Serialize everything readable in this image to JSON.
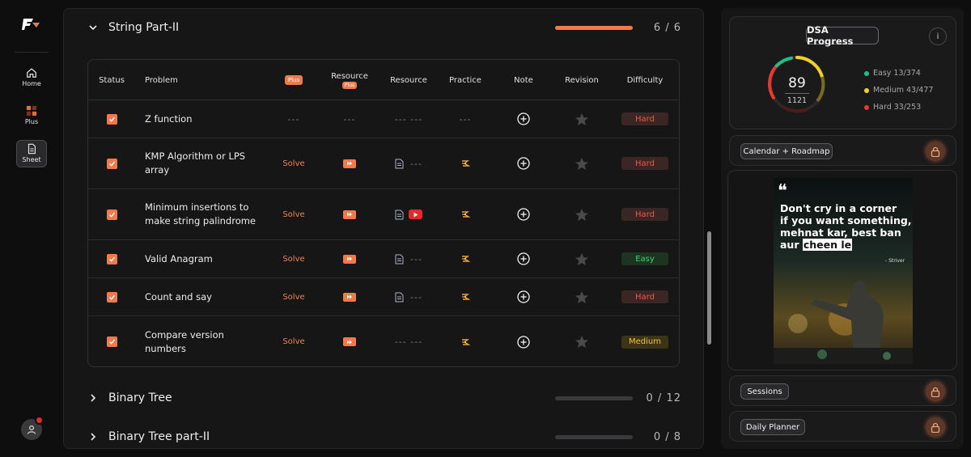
{
  "sidebar": {
    "items": [
      {
        "label": "Home",
        "icon": "home-icon"
      },
      {
        "label": "Plus",
        "icon": "plus-grid-icon"
      },
      {
        "label": "Sheet",
        "icon": "sheet-icon",
        "active": true
      }
    ]
  },
  "sections": [
    {
      "title": "String Part-II",
      "count": "6 / 6",
      "progress": 1.0,
      "expanded": true
    },
    {
      "title": "Binary Tree",
      "count": "0 / 12",
      "progress": 0.0,
      "expanded": false
    },
    {
      "title": "Binary Tree part-II",
      "count": "0 / 8",
      "progress": 0.0,
      "expanded": false
    }
  ],
  "table": {
    "headers": {
      "status": "Status",
      "problem": "Problem",
      "plus": "Plus",
      "resource_plus_label": "Resource",
      "resource_plus_tag": "Plus",
      "resource": "Resource",
      "practice": "Practice",
      "note": "Note",
      "revision": "Revision",
      "difficulty": "Difficulty"
    },
    "rows": [
      {
        "problem": "Z function",
        "plus": "---",
        "resource_plus": "---",
        "resource": "--- ---",
        "practice": "---",
        "difficulty": "Hard"
      },
      {
        "problem": "KMP Algorithm or LPS array",
        "plus": "Solve",
        "resource_plus": "video",
        "resource": "---",
        "practice": "codestudio",
        "difficulty": "Hard"
      },
      {
        "problem": "Minimum insertions to make string palindrome",
        "plus": "Solve",
        "resource_plus": "video",
        "resource": "youtube",
        "practice": "codestudio",
        "difficulty": "Hard"
      },
      {
        "problem": "Valid Anagram",
        "plus": "Solve",
        "resource_plus": "video",
        "resource": "---",
        "practice": "codestudio",
        "difficulty": "Easy"
      },
      {
        "problem": "Count and say",
        "plus": "Solve",
        "resource_plus": "video",
        "resource": "---",
        "practice": "codestudio",
        "difficulty": "Hard"
      },
      {
        "problem": "Compare version numbers",
        "plus": "Solve",
        "resource_plus": "video",
        "resource": "--- ---",
        "practice": "codestudio",
        "difficulty": "Medium"
      }
    ]
  },
  "progress": {
    "title": "DSA Progress",
    "info": "i",
    "solved": "89",
    "total": "1121",
    "easy": "Easy 13/374",
    "medium": "Medium 43/477",
    "hard": "Hard 33/253",
    "colors": {
      "easy": "#1fc18a",
      "medium": "#f2d024",
      "hard": "#e8372e"
    }
  },
  "links": {
    "calendar": "Calendar + Roadmap",
    "sessions": "Sessions",
    "planner": "Daily Planner"
  },
  "quote": {
    "mark": "❝",
    "line1": "Don't cry in a corner",
    "line2": "if you want something,",
    "line3": "mehnat kar, best ban",
    "line4a": "aur",
    "line4b": "cheen le",
    "author": "- Striver"
  }
}
